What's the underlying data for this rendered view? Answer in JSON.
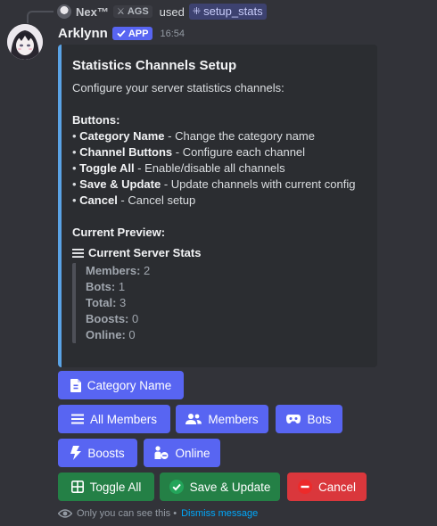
{
  "reply": {
    "user_name": "Nex™",
    "tag": "AGS",
    "used_label": "used",
    "command_name": "setup_stats"
  },
  "message": {
    "author_name": "Arklynn",
    "app_badge": "APP",
    "timestamp": "16:54"
  },
  "embed": {
    "accent_color": "#5aa3e6",
    "title": "Statistics Channels Setup",
    "description": "Configure your server statistics channels:",
    "buttons_heading": "Buttons:",
    "help_items": [
      {
        "name": "Category Name",
        "desc": " - Change the category name"
      },
      {
        "name": "Channel Buttons",
        "desc": " - Configure each channel"
      },
      {
        "name": "Toggle All",
        "desc": " - Enable/disable all channels"
      },
      {
        "name": "Save & Update",
        "desc": " - Update channels with current config"
      },
      {
        "name": "Cancel",
        "desc": " - Cancel setup"
      }
    ],
    "preview_heading": "Current Preview:",
    "stats_title": "Current Server Stats",
    "stats": [
      {
        "label": "Members:",
        "value": "2"
      },
      {
        "label": "Bots:",
        "value": "1"
      },
      {
        "label": "Total:",
        "value": "3"
      },
      {
        "label": "Boosts:",
        "value": "0"
      },
      {
        "label": "Online:",
        "value": "0"
      }
    ]
  },
  "buttons": {
    "category_name": "Category Name",
    "all_members": "All Members",
    "members": "Members",
    "bots": "Bots",
    "boosts": "Boosts",
    "online": "Online",
    "toggle_all": "Toggle All",
    "save_update": "Save & Update",
    "cancel": "Cancel"
  },
  "footer": {
    "only_you": "Only you can see this •",
    "dismiss": "Dismiss message"
  },
  "colors": {
    "blurple": "#5865f2",
    "success": "#248046",
    "danger": "#da373c",
    "link": "#00a8fc"
  }
}
